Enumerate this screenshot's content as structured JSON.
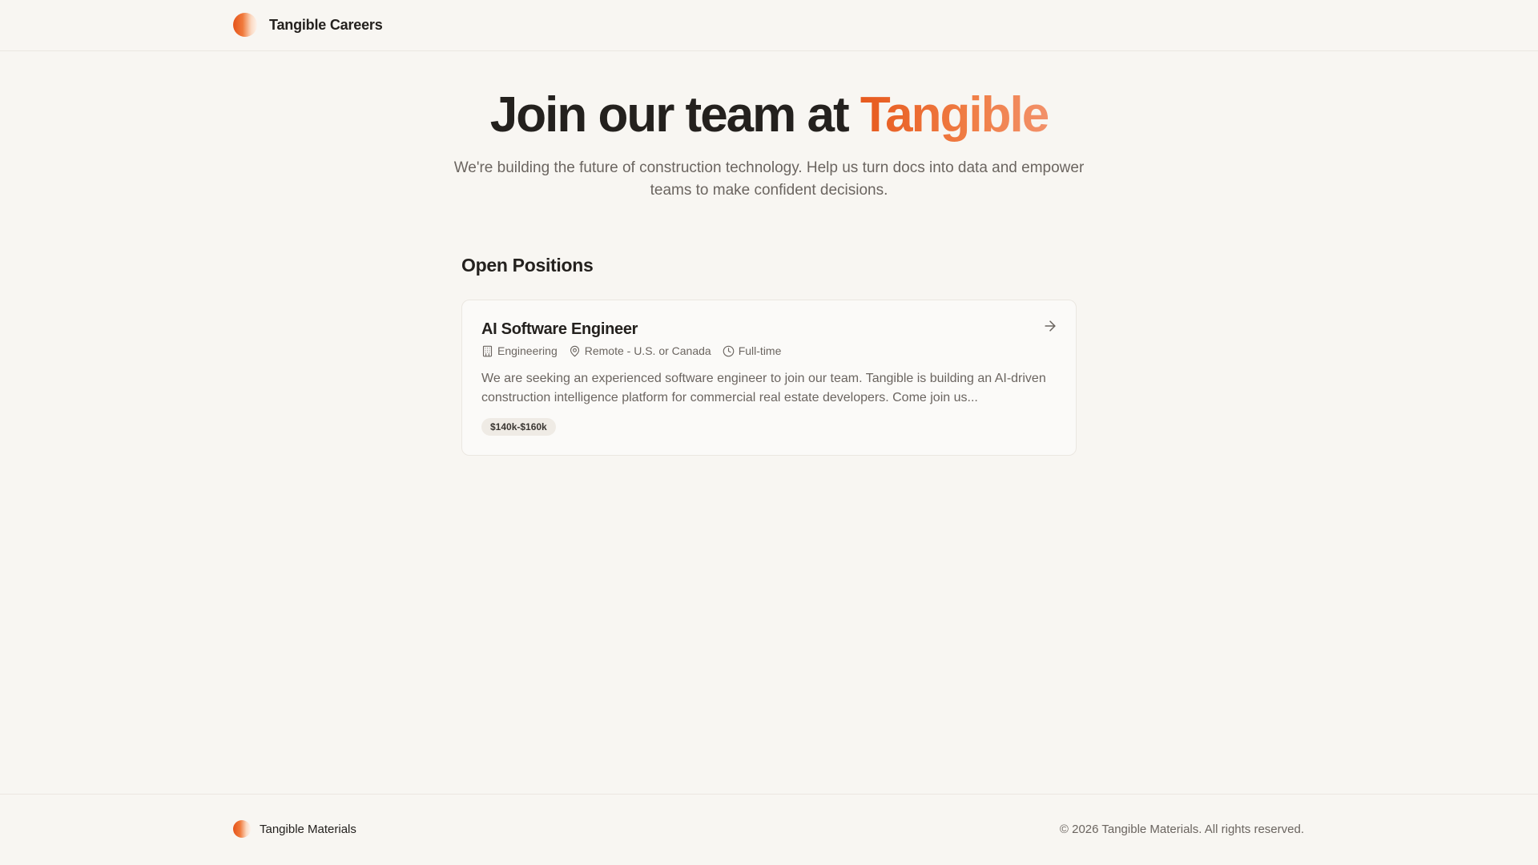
{
  "header": {
    "brand_name": "Tangible Careers",
    "logo_icon": "tangible-logo-icon"
  },
  "hero": {
    "title_prefix": "Join our team at",
    "title_accent": "Tangible",
    "subtitle": "We're building the future of construction technology. Help us turn docs into data and empower teams to make confident decisions."
  },
  "positions": {
    "section_title": "Open Positions",
    "jobs": [
      {
        "title": "AI Software Engineer",
        "department": "Engineering",
        "location": "Remote - U.S. or Canada",
        "type": "Full-time",
        "description": "We are seeking an experienced software engineer to join our team. Tangible is building an AI-driven construction intelligence platform for commercial real estate developers. Come join us...",
        "salary": "$140k-$160k",
        "icons": [
          "building-icon",
          "map-pin-icon",
          "clock-icon",
          "arrow-right-icon"
        ]
      }
    ]
  },
  "footer": {
    "brand_name": "Tangible Materials",
    "copyright": "© 2026 Tangible Materials. All rights reserved."
  },
  "colors": {
    "background": "#f8f6f2",
    "accent": "#e75a1e",
    "text": "#24211e",
    "muted": "#6b6560"
  }
}
